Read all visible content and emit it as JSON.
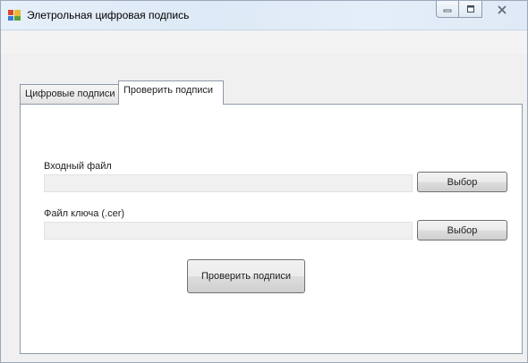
{
  "window": {
    "title": "Элетрольная цифровая подпись"
  },
  "tabs": [
    {
      "label": "Цифровые подписи",
      "active": false
    },
    {
      "label": "Проверить подписи",
      "active": true
    }
  ],
  "form": {
    "input_file_label": "Входный файл",
    "input_file_value": "",
    "input_browse_label": "Выбор",
    "key_file_label": "Файл ключа (.cer)",
    "key_file_value": "",
    "key_browse_label": "Выбор",
    "verify_button_label": "Проверить подписи"
  },
  "colors": {
    "titlebar": "#dde9f6",
    "window_bg": "#f0f0f0",
    "panel_bg": "#ffffff",
    "textbox_bg": "#f0f0f0"
  },
  "icons": {
    "app": "app-window-icon",
    "minimize": "minimize-icon",
    "maximize": "maximize-icon",
    "close": "close-icon"
  }
}
